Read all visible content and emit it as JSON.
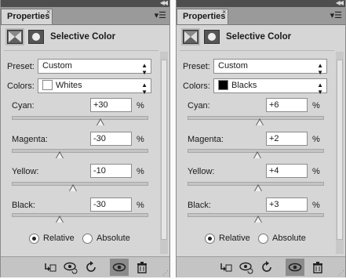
{
  "panels": [
    {
      "tab": "Properties",
      "title": "Selective Color",
      "preset_label": "Preset:",
      "preset_value": "Custom",
      "colors_label": "Colors:",
      "colors_value": "Whites",
      "colors_swatch": "#ffffff",
      "sliders": [
        {
          "label": "Cyan:",
          "value": "+30",
          "unit": "%",
          "level": 0.65
        },
        {
          "label": "Magenta:",
          "value": "-30",
          "unit": "%",
          "level": 0.35
        },
        {
          "label": "Yellow:",
          "value": "-10",
          "unit": "%",
          "level": 0.45
        },
        {
          "label": "Black:",
          "value": "-30",
          "unit": "%",
          "level": 0.35
        }
      ],
      "radio_relative": "Relative",
      "radio_absolute": "Absolute",
      "mode": "relative"
    },
    {
      "tab": "Properties",
      "title": "Selective Color",
      "preset_label": "Preset:",
      "preset_value": "Custom",
      "colors_label": "Colors:",
      "colors_value": "Blacks",
      "colors_swatch": "#000000",
      "sliders": [
        {
          "label": "Cyan:",
          "value": "+6",
          "unit": "%",
          "level": 0.53
        },
        {
          "label": "Magenta:",
          "value": "+2",
          "unit": "%",
          "level": 0.51
        },
        {
          "label": "Yellow:",
          "value": "+4",
          "unit": "%",
          "level": 0.52
        },
        {
          "label": "Black:",
          "value": "+3",
          "unit": "%",
          "level": 0.515
        }
      ],
      "radio_relative": "Relative",
      "radio_absolute": "Absolute",
      "mode": "relative"
    }
  ],
  "footer_icons": [
    "clip-to-layer-icon",
    "view-previous-state-icon",
    "reset-icon",
    "visibility-eye-icon",
    "trash-icon"
  ]
}
